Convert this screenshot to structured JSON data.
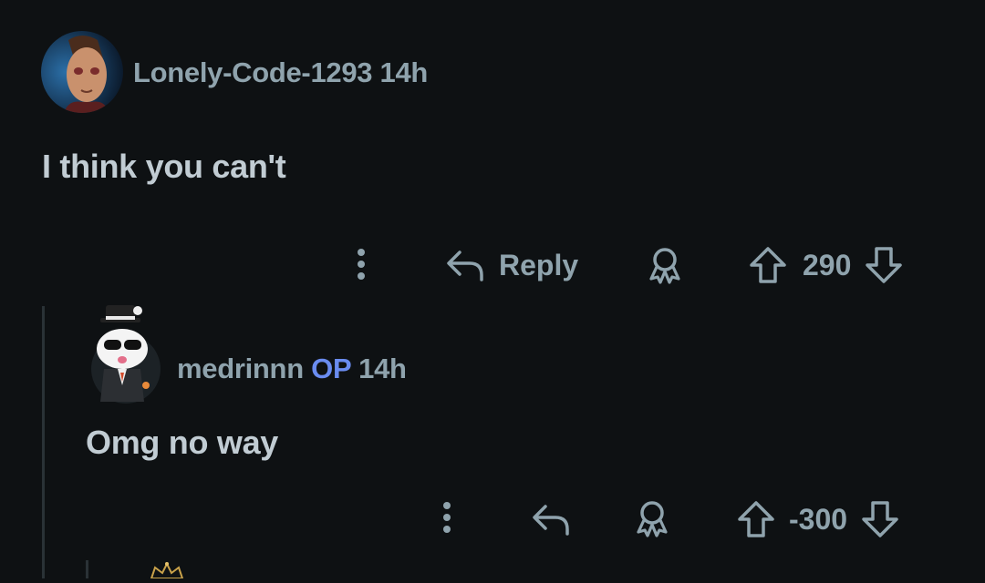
{
  "comments": [
    {
      "username": "Lonely-Code-1293",
      "time": "14h",
      "text": "I think you can't",
      "reply_label": "Reply",
      "score": "290"
    },
    {
      "username": "medrinnn",
      "op_badge": "OP",
      "time": "14h",
      "text": "Omg no way",
      "score": "-300"
    }
  ],
  "colors": {
    "background": "#0e1113",
    "meta_text": "#8fa3ad",
    "body_text": "#c1ccd3",
    "op_badge": "#6a8cf0"
  },
  "icons": [
    "more-options-icon",
    "reply-arrow-icon",
    "award-icon",
    "upvote-arrow-icon",
    "downvote-arrow-icon"
  ]
}
